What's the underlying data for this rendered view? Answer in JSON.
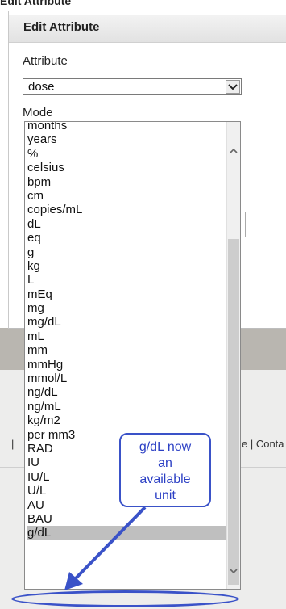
{
  "panel": {
    "title": "Edit Attribute",
    "attribute_label": "Attribute",
    "attribute_value": "dose",
    "mode_label": "Mode"
  },
  "unit_list": {
    "items": [
      "months",
      "years",
      "%",
      "celsius",
      "bpm",
      "cm",
      "copies/mL",
      "dL",
      "eq",
      "g",
      "kg",
      "L",
      "mEq",
      "mg",
      "mg/dL",
      "mL",
      "mm",
      "mmHg",
      "mmol/L",
      "ng/dL",
      "ng/mL",
      "kg/m2",
      "per mm3",
      "RAD",
      "IU",
      "IU/L",
      "U/L",
      "AU",
      "BAU",
      "g/dL"
    ],
    "selected": "g/dL"
  },
  "callout": {
    "lines": [
      "g/dL now",
      "an",
      "available",
      "unit"
    ]
  },
  "footer": {
    "left_fragment": "|",
    "right_fragment": "e | Conta"
  },
  "colors": {
    "callout_blue": "#3a52c8",
    "selected_bg": "#bfbfbf"
  }
}
